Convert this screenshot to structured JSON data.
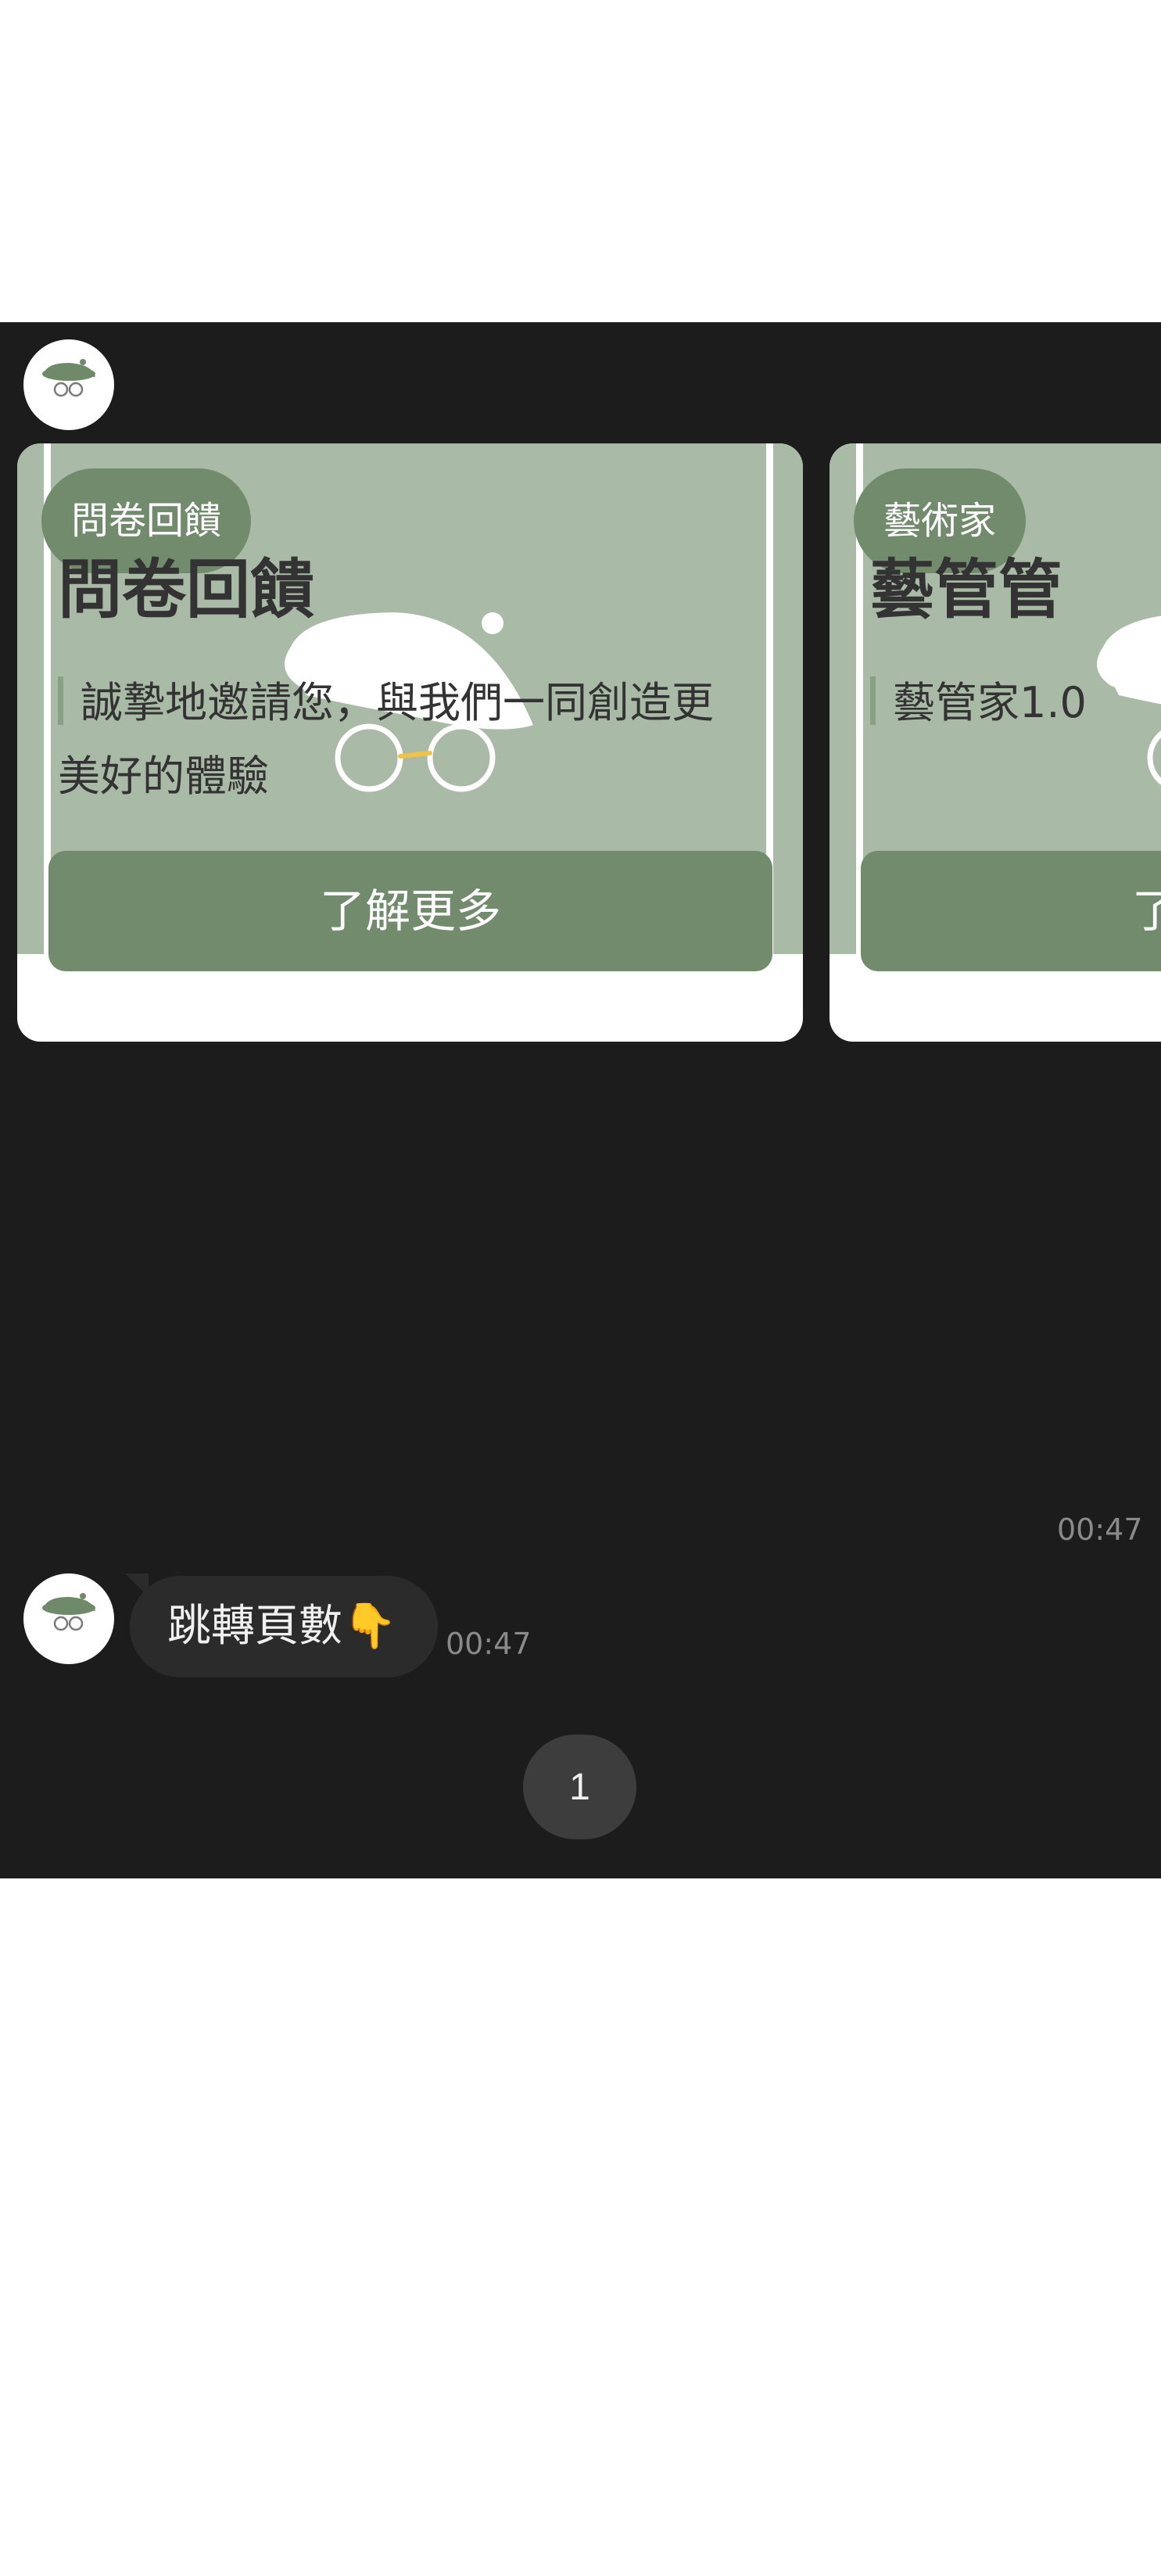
{
  "cards": [
    {
      "tag": "問卷回饋",
      "title": "問卷回饋",
      "description": "誠摯地邀請您，與我們一同創造更美好的體驗",
      "button_label": "了解更多"
    },
    {
      "tag": "藝術家",
      "title": "藝管管",
      "description": "藝管家1.0",
      "button_label": "了解更多"
    }
  ],
  "carousel_time": "00:47",
  "message": {
    "text": "跳轉頁數👇",
    "time": "00:47"
  },
  "pagination": {
    "current_page": "1"
  },
  "colors": {
    "chat_background": "#1c1c1c",
    "brand_green": "#728b6d",
    "hero_background": "#a9baa6",
    "bubble_background": "#2b2b2b"
  },
  "icons": {
    "avatar": "beret-glasses-logo-icon"
  }
}
